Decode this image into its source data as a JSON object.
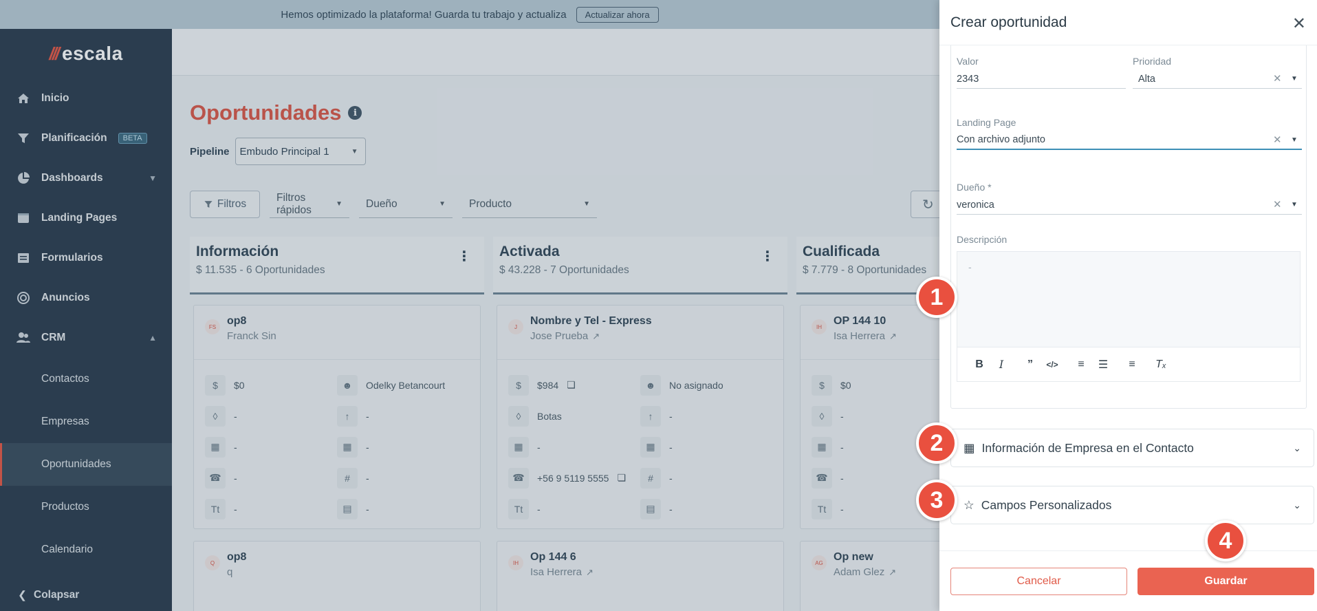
{
  "banner": {
    "message": "Hemos optimizado la plataforma! Guarda tu trabajo y actualiza",
    "button": "Actualizar ahora"
  },
  "brand": {
    "name": "escala"
  },
  "sidebar": {
    "items": [
      {
        "label": "Inicio",
        "icon": "home-icon"
      },
      {
        "label": "Planificación",
        "badge": "BETA",
        "icon": "funnel-icon"
      },
      {
        "label": "Dashboards",
        "icon": "pie-chart-icon"
      },
      {
        "label": "Landing Pages",
        "icon": "browser-icon"
      },
      {
        "label": "Formularios",
        "icon": "form-icon"
      },
      {
        "label": "Anuncios",
        "icon": "target-icon"
      },
      {
        "label": "CRM",
        "icon": "users-icon"
      }
    ],
    "crm_sub": [
      "Contactos",
      "Empresas",
      "Oportunidades",
      "Productos",
      "Calendario"
    ],
    "collapse": "Colapsar"
  },
  "main": {
    "title": "Oportunidades",
    "pipeline_label": "Pipeline",
    "pipeline_value": "Embudo Principal 1",
    "filters": {
      "button": "Filtros",
      "quick": "Filtros rápidos",
      "owner": "Dueño",
      "product": "Producto"
    }
  },
  "columns": [
    {
      "name": "Información",
      "summary": "$ 11.535 - 6 Oportunidades",
      "cards": [
        {
          "initials": "FS",
          "title": "op8",
          "sub": "Franck Sin",
          "cells": [
            "$0",
            "Odelky Betancourt",
            "-",
            "-",
            "-",
            "-",
            "-",
            "-",
            "-",
            "-"
          ]
        },
        {
          "initials": "Q",
          "title": "op8",
          "sub": "q"
        }
      ]
    },
    {
      "name": "Activada",
      "summary": "$ 43.228 - 7 Oportunidades",
      "cards": [
        {
          "initials": "J",
          "title": "Nombre y Tel - Express",
          "sub": "Jose Prueba",
          "cells": [
            "$984",
            "No asignado",
            "Botas",
            "-",
            "-",
            "-",
            "+56 9 5119 5555",
            "-",
            "-",
            "-"
          ]
        },
        {
          "initials": "IH",
          "title": "Op 144 6",
          "sub": "Isa Herrera"
        }
      ]
    },
    {
      "name": "Cualificada",
      "summary": "$ 7.779 - 8 Oportunidades",
      "cards": [
        {
          "initials": "IH",
          "title": "OP 144 10",
          "sub": "Isa Herrera",
          "cells": [
            "$0",
            "",
            "-",
            "",
            "-",
            "",
            "-",
            "",
            "-",
            ""
          ]
        },
        {
          "initials": "AG",
          "title": "Op new",
          "sub": "Adam Glez"
        }
      ]
    }
  ],
  "drawer": {
    "title": "Crear oportunidad",
    "valor_label": "Valor",
    "valor": "2343",
    "prioridad_label": "Prioridad",
    "prioridad": "Alta",
    "landing_label": "Landing Page",
    "landing": "Con archivo adjunto",
    "owner_label": "Dueño *",
    "owner": "veronica",
    "desc_label": "Descripción",
    "desc_placeholder": "-",
    "accordion1": "Información de Empresa en el Contacto",
    "accordion2": "Campos Personalizados",
    "cancel": "Cancelar",
    "save": "Guardar"
  },
  "steps": [
    "1",
    "2",
    "3",
    "4"
  ],
  "colors": {
    "accent": "#e9503f",
    "sidebar": "#2c3e50",
    "title": "#d9584a"
  }
}
